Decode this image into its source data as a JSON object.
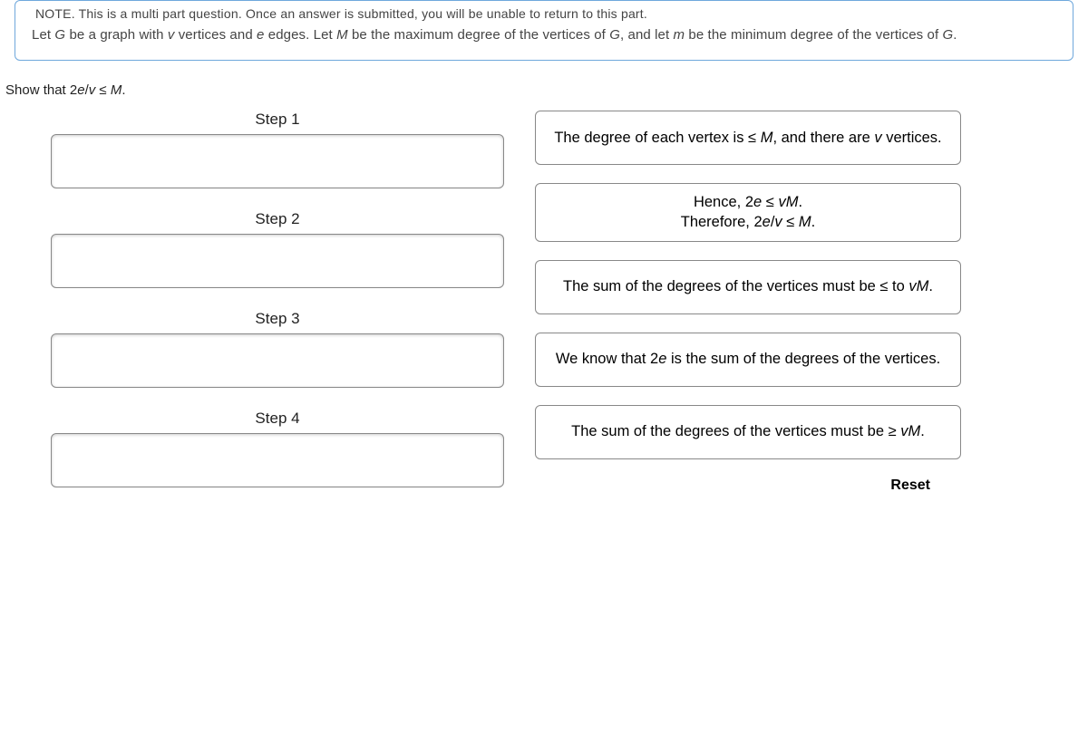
{
  "note": {
    "cutoff": "NOTE. This is a multi part question. Once an answer is submitted, you will be unable to return to this part.",
    "body_html": "Let <span class='it'>G</span> be a graph with <span class='it'>v</span> vertices and <span class='it'>e</span> edges. Let <span class='it'>M</span> be the maximum degree of the vertices of <span class='it'>G</span>, and let <span class='it'>m</span> be the minimum degree of the vertices of <span class='it'>G</span>."
  },
  "prompt_html": "Show that 2<span class='it'>e</span>/<span class='it'>v</span> &le; <span class='it'>M</span>.",
  "steps": {
    "s1": "Step 1",
    "s2": "Step 2",
    "s3": "Step 3",
    "s4": "Step 4"
  },
  "choices": {
    "c1_html": "The degree of each vertex is &le; <span class='it'>M</span>, and there are <span class='it'>v</span> vertices.",
    "c2_html": "Hence, 2<span class='it'>e</span> &le; <span class='it'>vM</span>.<br>Therefore, 2<span class='it'>e</span>/<span class='it'>v</span> &le; <span class='it'>M</span>.",
    "c3_html": "The sum of the degrees of the vertices must be &le; to <span class='it'>vM</span>.",
    "c4_html": "We know that 2<span class='it'>e</span> is the sum of the degrees of the vertices.",
    "c5_html": "The sum of the degrees of the vertices must be &ge; <span class='it'>vM</span>."
  },
  "reset": "Reset"
}
